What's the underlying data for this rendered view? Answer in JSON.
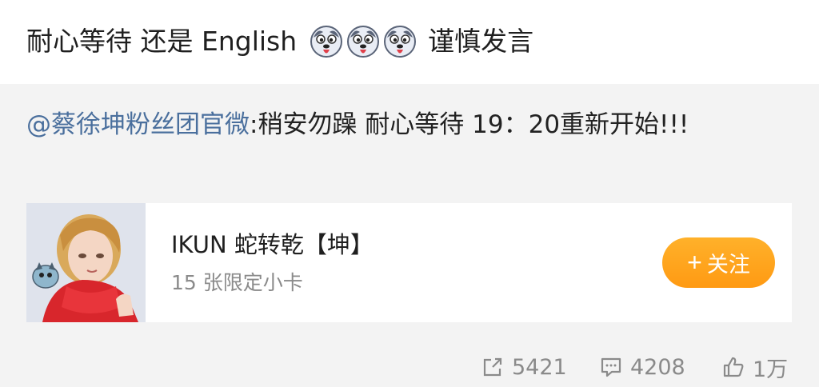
{
  "post": {
    "text_part1": "耐心等待 还是 English",
    "emojis": [
      "husky-emoji",
      "husky-emoji",
      "husky-emoji"
    ],
    "text_part2": "谨慎发言"
  },
  "repost": {
    "mention": "@蔡徐坤粉丝团官微",
    "text": ":稍安勿躁 耐心等待 19：20重新开始!!!"
  },
  "card": {
    "title": "IKUN 蛇转乾【坤】",
    "subtitle": "15 张限定小卡",
    "follow_label": "关注",
    "follow_plus": "+"
  },
  "actions": {
    "repost_count": "5421",
    "comment_count": "4208",
    "like_count": "1万"
  },
  "colors": {
    "mention": "#4a6f9d",
    "follow_button": "#ffa11c",
    "repost_bg": "#f3f3f3"
  }
}
